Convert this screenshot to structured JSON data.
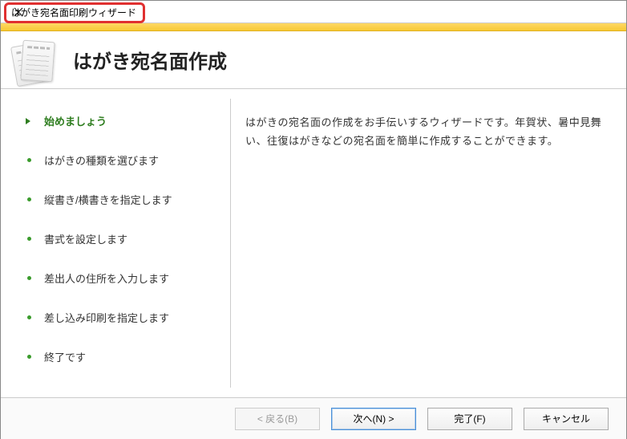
{
  "window": {
    "title": "はがき宛名面印刷ウィザード"
  },
  "header": {
    "title": "はがき宛名面作成"
  },
  "steps": {
    "items": [
      {
        "label": "始めましょう",
        "current": true
      },
      {
        "label": "はがきの種類を選びます",
        "current": false
      },
      {
        "label": "縦書き/横書きを指定します",
        "current": false
      },
      {
        "label": "書式を設定します",
        "current": false
      },
      {
        "label": "差出人の住所を入力します",
        "current": false
      },
      {
        "label": "差し込み印刷を指定します",
        "current": false
      },
      {
        "label": "終了です",
        "current": false
      }
    ]
  },
  "content": {
    "intro_text": "はがきの宛名面の作成をお手伝いするウィザードです。年賀状、暑中見舞い、往復はがきなどの宛名面を簡単に作成することができます。"
  },
  "buttons": {
    "back": "< 戻る(B)",
    "next": "次へ(N) >",
    "finish": "完了(F)",
    "cancel": "キャンセル"
  }
}
